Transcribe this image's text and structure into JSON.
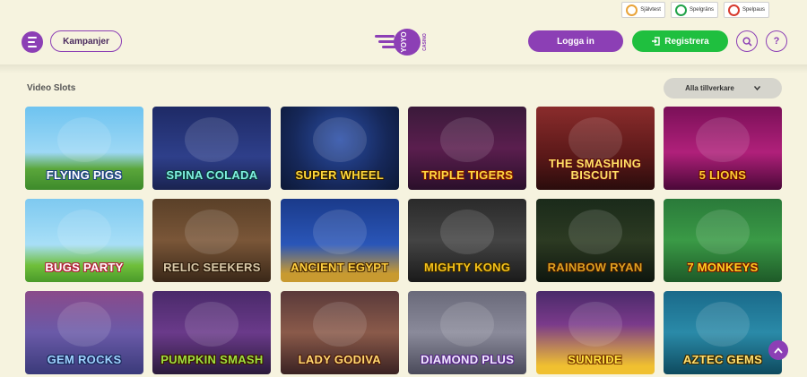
{
  "utility": {
    "items": [
      {
        "label": "Självtest",
        "color": "#e9a43a"
      },
      {
        "label": "Spelgräns",
        "color": "#22a34a"
      },
      {
        "label": "Spelpaus",
        "color": "#d73b2f"
      }
    ]
  },
  "header": {
    "menu_icon": "hamburger-icon",
    "kampanjer": "Kampanjer",
    "logo_text": "YOYO",
    "logo_sub": "CASINO",
    "login": "Logga in",
    "register": "Registrera",
    "register_icon": "arrow-enter-icon",
    "search_icon": "search-icon",
    "help_icon": "help-icon",
    "help_glyph": "?"
  },
  "section": {
    "title": "Video Slots",
    "filter": "Alla tillverkare",
    "filter_icon": "chevron-down-icon"
  },
  "games": [
    {
      "title": "Flying Pigs",
      "bg": "linear-gradient(#6ec3f0,#9dd8f5 55%,#5aa63a 75%,#3d8a2b)",
      "color": "#ffffff",
      "stroke": "#1b3f82"
    },
    {
      "title": "Spina Colada",
      "bg": "linear-gradient(#1e2a66,#2e3f8a 60%,#1a2350)",
      "color": "#7ef0e0",
      "stroke": "#0b3a3a"
    },
    {
      "title": "Super Wheel",
      "bg": "radial-gradient(circle at 50% 40%,#2b4fa8,#16285a 60%,#0c1836)",
      "color": "#ffd83a",
      "stroke": "#2a1a00"
    },
    {
      "title": "Triple Tigers",
      "bg": "linear-gradient(#3a1a3a,#5a1e4e 50%,#2a0f2a)",
      "color": "#ffd640",
      "stroke": "#7a1500"
    },
    {
      "title": "The Smashing Biscuit",
      "bg": "linear-gradient(#8a2c2c,#5a1818 60%,#2a0c0c)",
      "color": "#ffe066",
      "stroke": "#5a0c0c"
    },
    {
      "title": "5 Lions",
      "bg": "linear-gradient(#7a1058,#b0207a 55%,#4a0838)",
      "color": "#ffcc33",
      "stroke": "#6a0a00"
    },
    {
      "title": "Bugs Party",
      "bg": "linear-gradient(#7ec9f0,#a8dff7 55%,#6fbf3a 80%,#4a9a2a)",
      "color": "#ffffff",
      "stroke": "#b4203a"
    },
    {
      "title": "Relic Seekers",
      "bg": "linear-gradient(#5a4028,#7a5638 50%,#3a2818)",
      "color": "#d8c8a8",
      "stroke": "#2a1a0a"
    },
    {
      "title": "Ancient Egypt",
      "bg": "linear-gradient(#1a3a8a,#2a56b8 55%,#c89a30 90%)",
      "color": "#ffd040",
      "stroke": "#4a2a00"
    },
    {
      "title": "Mighty Kong",
      "bg": "linear-gradient(#2a2a2a,#444 50%,#1a1a1a)",
      "color": "#f6c21a",
      "stroke": "#3a2a00"
    },
    {
      "title": "Rainbow Ryan",
      "bg": "linear-gradient(#1a2a1a,#2c3a22 50%,#0e160e)",
      "color": "#e0a020",
      "stroke": "#3a1a00"
    },
    {
      "title": "7 Monkeys",
      "bg": "linear-gradient(#2a7a3a,#3a9a46 50%,#1e5a28)",
      "color": "#ffd020",
      "stroke": "#7a1a00"
    },
    {
      "title": "Gem Rocks",
      "bg": "linear-gradient(#8a4a8a,#6a5aa8 50%,#3a3a7a)",
      "color": "#9fd2ff",
      "stroke": "#1a2a5a"
    },
    {
      "title": "Pumpkin Smash",
      "bg": "linear-gradient(#4a2a6a,#6a3a8a 50%,#2a1a3a)",
      "color": "#9de040",
      "stroke": "#3a1a00"
    },
    {
      "title": "Lady Godiva",
      "bg": "linear-gradient(#5a3a3a,#8a5a4a 50%,#3a2222)",
      "color": "#ffd870",
      "stroke": "#4a1a0a"
    },
    {
      "title": "Diamond Plus",
      "bg": "linear-gradient(#6a6a7a,#8a8a9a 50%,#4a4a5a)",
      "color": "#f0e8ff",
      "stroke": "#5a2a8a"
    },
    {
      "title": "Sunride",
      "bg": "linear-gradient(#4a2a6a,#7a3a8a 40%,#f0c030 90%)",
      "color": "#ffe040",
      "stroke": "#7a3a00"
    },
    {
      "title": "Aztec Gems",
      "bg": "linear-gradient(#1a6a8a,#2a8aa8 50%,#0e4a5e)",
      "color": "#ffe070",
      "stroke": "#3a2a00"
    }
  ],
  "scroll_top_icon": "arrow-up-icon"
}
